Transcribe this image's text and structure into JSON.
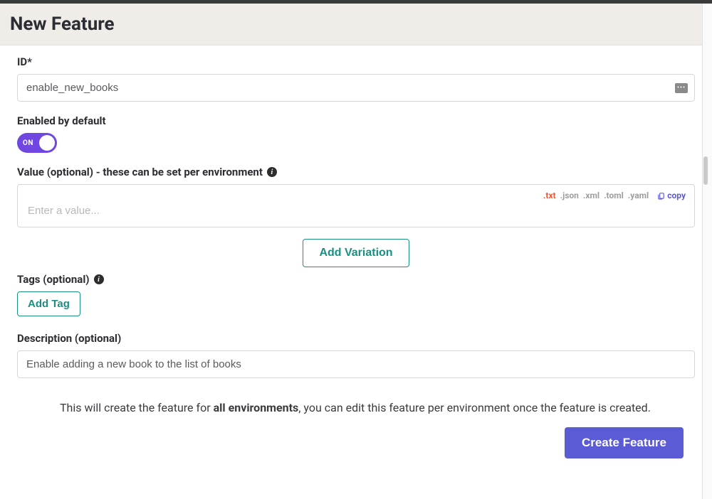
{
  "header": {
    "title": "New Feature"
  },
  "idField": {
    "label": "ID*",
    "value": "enable_new_books"
  },
  "enabledField": {
    "label": "Enabled by default",
    "toggleState": "ON"
  },
  "valueField": {
    "label": "Value (optional) - these can be set per environment",
    "placeholder": "Enter a value...",
    "formats": [
      ".txt",
      ".json",
      ".xml",
      ".toml",
      ".yaml"
    ],
    "activeFormat": ".txt",
    "copyLabel": "copy"
  },
  "addVariationLabel": "Add Variation",
  "tagsField": {
    "label": "Tags (optional)",
    "addTagLabel": "Add Tag"
  },
  "descriptionField": {
    "label": "Description (optional)",
    "value": "Enable adding a new book to the list of books"
  },
  "note": {
    "prefix": "This will create the feature for ",
    "bold": "all environments",
    "suffix": ", you can edit this feature per environment once the feature is created."
  },
  "createButton": "Create Feature"
}
